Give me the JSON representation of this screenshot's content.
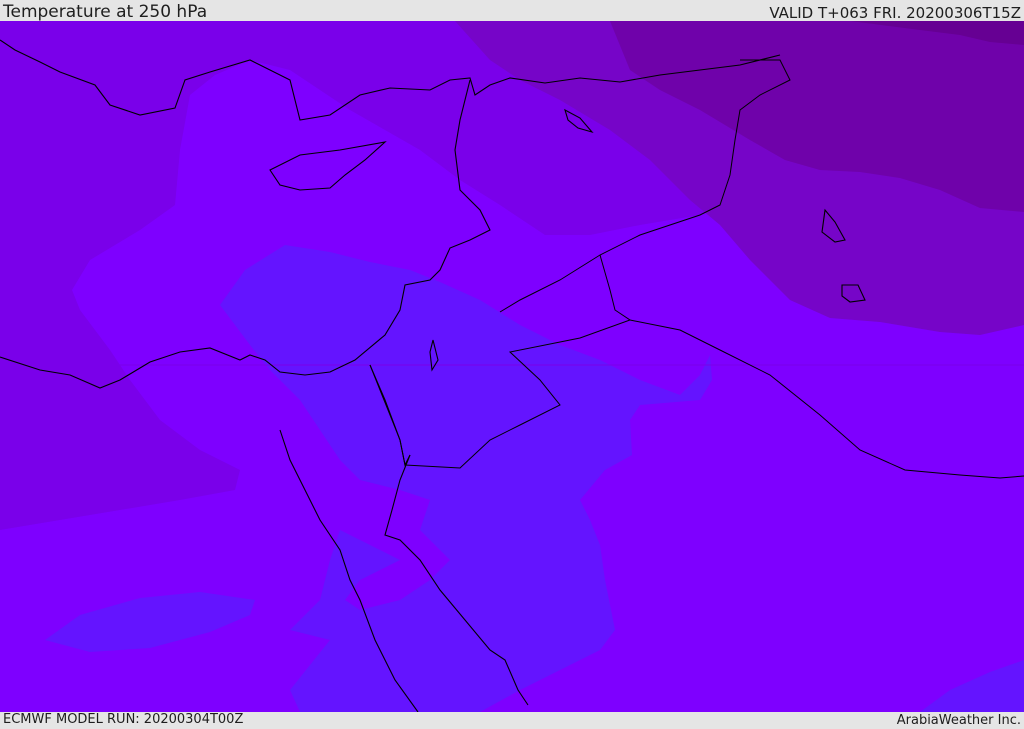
{
  "header": {
    "title": "Temperature at 250 hPa",
    "valid_time": "VALID T+063 FRI. 20200306T15Z"
  },
  "footer": {
    "model_run": "ECMWF MODEL RUN: 20200304T00Z",
    "credit": "ArabiaWeather Inc."
  },
  "colors": {
    "bar_background": "#e5e5e5",
    "text": "#1e1e1e",
    "field_base": "#7e00ff",
    "field_violet": "#7a00ea",
    "field_purple": "#7605c8",
    "field_plum": "#6f02aa",
    "field_darkest": "#660093",
    "field_indigo": "#6414ff",
    "coastline": "#000000"
  }
}
